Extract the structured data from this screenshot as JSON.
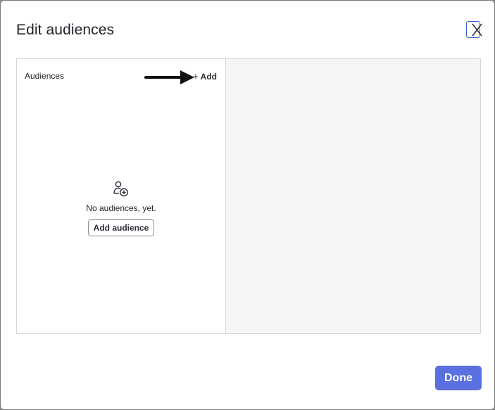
{
  "dialog": {
    "title": "Edit audiences",
    "close_icon": "close-x-icon",
    "done_label": "Done"
  },
  "audiences_pane": {
    "header": "Audiences",
    "add_label": "Add",
    "add_icon": "plus-icon",
    "empty_icon": "person-add-icon",
    "empty_message": "No audiences, yet.",
    "add_audience_label": "Add audience"
  },
  "annotation": {
    "arrow_icon": "arrow-right-icon"
  },
  "colors": {
    "accent": "#5a6fe0",
    "close_border": "#3b5bdb",
    "right_pane_bg": "#f4f5f7"
  }
}
